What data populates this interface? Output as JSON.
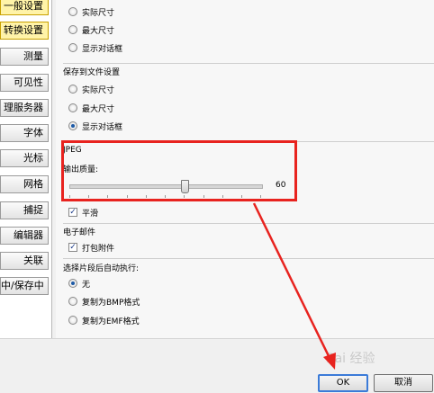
{
  "sidebar": {
    "items": [
      {
        "label": "一般设置",
        "active": true
      },
      {
        "label": "转换设置",
        "active": true
      },
      {
        "label": "测量",
        "active": false
      },
      {
        "label": "可见性",
        "active": false
      },
      {
        "label": "理服务器",
        "active": false
      },
      {
        "label": "字体",
        "active": false
      },
      {
        "label": "光标",
        "active": false
      },
      {
        "label": "网格",
        "active": false
      },
      {
        "label": "捕捉",
        "active": false
      },
      {
        "label": "编辑器",
        "active": false
      },
      {
        "label": "关联",
        "active": false
      },
      {
        "label": "中/保存中",
        "active": false
      }
    ]
  },
  "clipboard_group": {
    "options": [
      {
        "label": "实际尺寸",
        "selected": false
      },
      {
        "label": "最大尺寸",
        "selected": false
      },
      {
        "label": "显示对话框",
        "selected": true
      }
    ]
  },
  "save_file_group": {
    "title": "保存到文件设置",
    "options": [
      {
        "label": "实际尺寸",
        "selected": false
      },
      {
        "label": "最大尺寸",
        "selected": false
      },
      {
        "label": "显示对话框",
        "selected": true
      }
    ]
  },
  "jpeg_group": {
    "title": "JPEG",
    "quality_label": "输出质量:",
    "quality_value": "60",
    "quality_fraction": 0.6
  },
  "smooth": {
    "label": "平滑",
    "checked": true
  },
  "email_group": {
    "title": "电子邮件",
    "pack_attach": {
      "label": "打包附件",
      "checked": true
    }
  },
  "auto_exec_group": {
    "title": "选择片段后自动执行:",
    "options": [
      {
        "label": "无",
        "selected": true
      },
      {
        "label": "复制为BMP格式",
        "selected": false
      },
      {
        "label": "复制为EMF格式",
        "selected": false
      }
    ]
  },
  "buttons": {
    "ok": "OK",
    "cancel": "取消"
  },
  "watermark": "Bai 经验",
  "colors": {
    "highlight": "#e8231f",
    "active_tab": "#fff3a8",
    "default_button_border": "#3b7bd8"
  }
}
